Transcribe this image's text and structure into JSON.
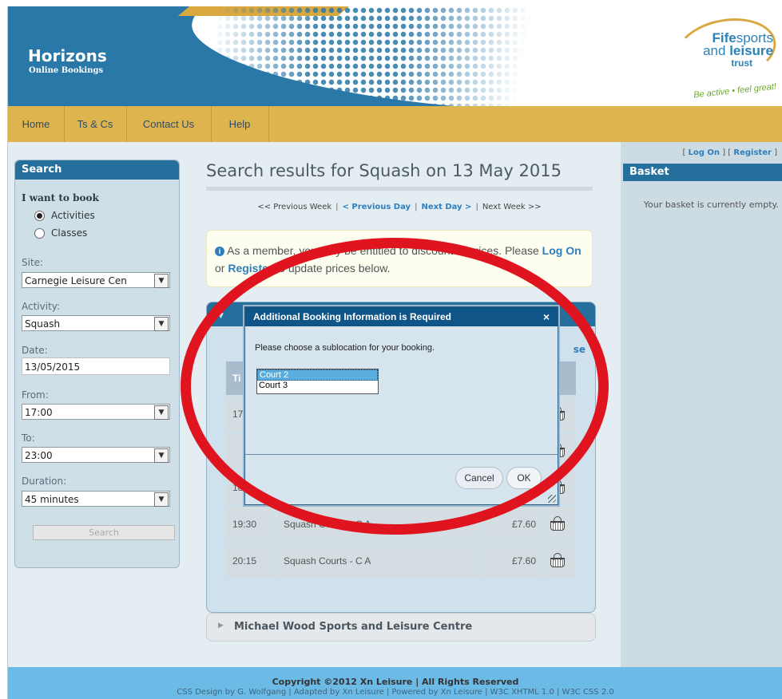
{
  "header": {
    "brand_title": "Horizons",
    "brand_subtitle": "Online Bookings",
    "logo": {
      "line1_bold": "Fife",
      "line1_rest": "sports",
      "line2_pre": "and ",
      "line2_bold": "leisure",
      "line3": "trust",
      "tagline": "Be active • feel great!"
    }
  },
  "nav": {
    "items": [
      {
        "label": "Home"
      },
      {
        "label": "Ts & Cs"
      },
      {
        "label": "Contact Us"
      },
      {
        "label": "Help"
      }
    ]
  },
  "search": {
    "heading": "Search",
    "i_want_to_book": "I want to book",
    "options": [
      "Activities",
      "Classes"
    ],
    "selected_option": "Activities",
    "site_label": "Site:",
    "site_value": "Carnegie Leisure Cen",
    "activity_label": "Activity:",
    "activity_value": "Squash",
    "date_label": "Date:",
    "date_value": "13/05/2015",
    "from_label": "From:",
    "from_value": "17:00",
    "to_label": "To:",
    "to_value": "23:00",
    "duration_label": "Duration:",
    "duration_value": "45 minutes",
    "search_button": "Search"
  },
  "main": {
    "title": "Search results for Squash on 13 May 2015",
    "pager": {
      "prev_week": "<< Previous Week",
      "prev_day": "< Previous Day",
      "next_day": "Next Day >",
      "next_week": "Next Week >>",
      "sep": "|"
    },
    "info": {
      "icon": "i",
      "text1": "As a member, you may be entitled to discounted prices. Please",
      "log_on": "Log On",
      "or": "or",
      "register": "Register",
      "text2": "to update prices below."
    },
    "results": {
      "see_link": "se",
      "header_partial": "Ti",
      "rows": [
        {
          "time": "17",
          "name": "",
          "price": ""
        },
        {
          "time": "",
          "name": "",
          "price": ""
        },
        {
          "time": "18",
          "name": "",
          "price": ""
        },
        {
          "time": "19:30",
          "name": "Squash Courts - C A",
          "price": "£7.60"
        },
        {
          "time": "20:15",
          "name": "Squash Courts - C A",
          "price": "£7.60"
        }
      ]
    },
    "collapsed_centre": "Michael Wood Sports and Leisure Centre"
  },
  "sidebar_right": {
    "log_on": "Log On",
    "register": "Register",
    "basket_heading": "Basket",
    "basket_empty": "Your basket is currently empty."
  },
  "footer": {
    "copyright": "Copyright ©2012 Xn Leisure | All Rights Reserved",
    "credits": "CSS Design by G. Wolfgang | Adapted by Xn Leisure | Powered by Xn Leisure | W3C XHTML 1.0 | W3C CSS 2.0"
  },
  "modal": {
    "title": "Additional Booking Information is Required",
    "close": "×",
    "message": "Please choose a sublocation for your booking.",
    "options": [
      "Court 2",
      "Court 3"
    ],
    "selected": "Court 2",
    "cancel": "Cancel",
    "ok": "OK"
  },
  "colors": {
    "header_blue": "#2a78a8",
    "nav_gold": "#deb44e",
    "panel_head": "#256f9c",
    "link_blue": "#2f7fbe",
    "annotation_red": "#e0141e"
  }
}
